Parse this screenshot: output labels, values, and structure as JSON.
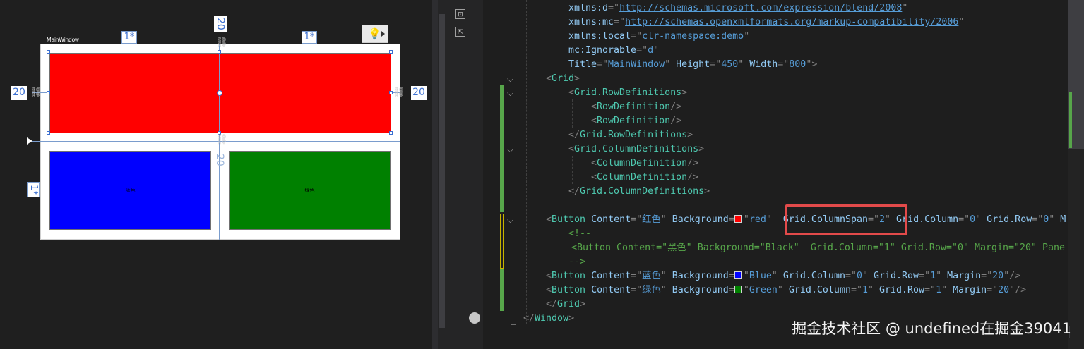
{
  "designer": {
    "window_title": "MainWindow",
    "column_star_left": "1*",
    "column_star_right": "1*",
    "row_star": "1*",
    "margin_top": "20",
    "margin_left": "20",
    "margin_right": "20",
    "margin_middle": "20",
    "red_caption": "",
    "blue_caption": "蓝色",
    "green_caption": "绿色",
    "colors": {
      "red": "#ff0000",
      "blue": "#0000ff",
      "green": "#008000"
    }
  },
  "editor": {
    "highlight_color": "#e24a4a",
    "lines": [
      {
        "id": "l1",
        "parts": [
          [
            "attr",
            "xmlns:d"
          ],
          [
            "punc",
            "=\""
          ],
          [
            "link",
            "http://schemas.microsoft.com/expression/blend/2008"
          ],
          [
            "punc",
            "\""
          ]
        ]
      },
      {
        "id": "l2",
        "parts": [
          [
            "attr",
            "xmlns:mc"
          ],
          [
            "punc",
            "=\""
          ],
          [
            "link",
            "http://schemas.openxmlformats.org/markup-compatibility/2006"
          ],
          [
            "punc",
            "\""
          ]
        ]
      },
      {
        "id": "l3",
        "parts": [
          [
            "attr",
            "xmlns:local"
          ],
          [
            "punc",
            "=\""
          ],
          [
            "val",
            "clr-namespace:demo"
          ],
          [
            "punc",
            "\""
          ]
        ]
      },
      {
        "id": "l4",
        "parts": [
          [
            "attr",
            "mc:Ignorable"
          ],
          [
            "punc",
            "=\""
          ],
          [
            "val",
            "d"
          ],
          [
            "punc",
            "\""
          ]
        ]
      },
      {
        "id": "l5",
        "parts": [
          [
            "attr",
            "Title"
          ],
          [
            "punc",
            "=\""
          ],
          [
            "val",
            "MainWindow"
          ],
          [
            "punc",
            "\" "
          ],
          [
            "attr",
            "Height"
          ],
          [
            "punc",
            "=\""
          ],
          [
            "val",
            "450"
          ],
          [
            "punc",
            "\" "
          ],
          [
            "attr",
            "Width"
          ],
          [
            "punc",
            "=\""
          ],
          [
            "val",
            "800"
          ],
          [
            "punc",
            "\">"
          ]
        ]
      },
      {
        "id": "l6",
        "parts": [
          [
            "punc",
            "<"
          ],
          [
            "tag",
            "Grid"
          ],
          [
            "punc",
            ">"
          ]
        ]
      },
      {
        "id": "l7",
        "parts": [
          [
            "punc",
            "<"
          ],
          [
            "tag",
            "Grid.RowDefinitions"
          ],
          [
            "punc",
            ">"
          ]
        ]
      },
      {
        "id": "l8",
        "parts": [
          [
            "punc",
            "<"
          ],
          [
            "tag",
            "RowDefinition"
          ],
          [
            "punc",
            "/>"
          ]
        ]
      },
      {
        "id": "l9",
        "parts": [
          [
            "punc",
            "<"
          ],
          [
            "tag",
            "RowDefinition"
          ],
          [
            "punc",
            "/>"
          ]
        ]
      },
      {
        "id": "l10",
        "parts": [
          [
            "punc",
            "</"
          ],
          [
            "tag",
            "Grid.RowDefinitions"
          ],
          [
            "punc",
            ">"
          ]
        ]
      },
      {
        "id": "l11",
        "parts": [
          [
            "punc",
            "<"
          ],
          [
            "tag",
            "Grid.ColumnDefinitions"
          ],
          [
            "punc",
            ">"
          ]
        ]
      },
      {
        "id": "l12",
        "parts": [
          [
            "punc",
            "<"
          ],
          [
            "tag",
            "ColumnDefinition"
          ],
          [
            "punc",
            "/>"
          ]
        ]
      },
      {
        "id": "l13",
        "parts": [
          [
            "punc",
            "<"
          ],
          [
            "tag",
            "ColumnDefinition"
          ],
          [
            "punc",
            "/>"
          ]
        ]
      },
      {
        "id": "l14",
        "parts": [
          [
            "punc",
            "</"
          ],
          [
            "tag",
            "Grid.ColumnDefinitions"
          ],
          [
            "punc",
            ">"
          ]
        ]
      },
      {
        "id": "l15",
        "parts": [
          [
            "punc",
            "<"
          ],
          [
            "tag",
            "Button"
          ],
          [
            "text",
            " "
          ],
          [
            "attr",
            "Content"
          ],
          [
            "punc",
            "=\""
          ],
          [
            "val",
            "红色"
          ],
          [
            "punc",
            "\" "
          ],
          [
            "attr",
            "Background"
          ],
          [
            "punc",
            "="
          ],
          [
            "swatch",
            "#ff0000"
          ],
          [
            "punc",
            "\""
          ],
          [
            "val",
            "red"
          ],
          [
            "punc",
            "\"  "
          ],
          [
            "attr",
            "Grid.ColumnSpan"
          ],
          [
            "punc",
            "=\""
          ],
          [
            "val",
            "2"
          ],
          [
            "punc",
            "\" "
          ],
          [
            "attr",
            "Grid.Column"
          ],
          [
            "punc",
            "=\""
          ],
          [
            "val",
            "0"
          ],
          [
            "punc",
            "\" "
          ],
          [
            "attr",
            "Grid.Row"
          ],
          [
            "punc",
            "=\""
          ],
          [
            "val",
            "0"
          ],
          [
            "punc",
            "\" "
          ],
          [
            "attr",
            "M"
          ]
        ]
      },
      {
        "id": "l16",
        "parts": [
          [
            "cmt",
            "<!--"
          ]
        ]
      },
      {
        "id": "l17",
        "parts": [
          [
            "cmt",
            "<Button Content=\"黑色\" Background=\"Black\"  Grid.Column=\"1\" Grid.Row=\"0\" Margin=\"20\" Pane"
          ]
        ]
      },
      {
        "id": "l18",
        "parts": [
          [
            "cmt",
            "-->"
          ]
        ]
      },
      {
        "id": "l19",
        "parts": [
          [
            "punc",
            "<"
          ],
          [
            "tag",
            "Button"
          ],
          [
            "text",
            " "
          ],
          [
            "attr",
            "Content"
          ],
          [
            "punc",
            "=\""
          ],
          [
            "val",
            "蓝色"
          ],
          [
            "punc",
            "\" "
          ],
          [
            "attr",
            "Background"
          ],
          [
            "punc",
            "="
          ],
          [
            "swatch",
            "#0000ff"
          ],
          [
            "punc",
            "\""
          ],
          [
            "val",
            "Blue"
          ],
          [
            "punc",
            "\" "
          ],
          [
            "attr",
            "Grid.Column"
          ],
          [
            "punc",
            "=\""
          ],
          [
            "val",
            "0"
          ],
          [
            "punc",
            "\" "
          ],
          [
            "attr",
            "Grid.Row"
          ],
          [
            "punc",
            "=\""
          ],
          [
            "val",
            "1"
          ],
          [
            "punc",
            "\" "
          ],
          [
            "attr",
            "Margin"
          ],
          [
            "punc",
            "=\""
          ],
          [
            "val",
            "20"
          ],
          [
            "punc",
            "\"/>"
          ]
        ]
      },
      {
        "id": "l20",
        "parts": [
          [
            "punc",
            "<"
          ],
          [
            "tag",
            "Button"
          ],
          [
            "text",
            " "
          ],
          [
            "attr",
            "Content"
          ],
          [
            "punc",
            "=\""
          ],
          [
            "val",
            "绿色"
          ],
          [
            "punc",
            "\" "
          ],
          [
            "attr",
            "Background"
          ],
          [
            "punc",
            "="
          ],
          [
            "swatch",
            "#008000"
          ],
          [
            "punc",
            "\""
          ],
          [
            "val",
            "Green"
          ],
          [
            "punc",
            "\" "
          ],
          [
            "attr",
            "Grid.Column"
          ],
          [
            "punc",
            "=\""
          ],
          [
            "val",
            "1"
          ],
          [
            "punc",
            "\" "
          ],
          [
            "attr",
            "Grid.Row"
          ],
          [
            "punc",
            "=\""
          ],
          [
            "val",
            "1"
          ],
          [
            "punc",
            "\" "
          ],
          [
            "attr",
            "Margin"
          ],
          [
            "punc",
            "=\""
          ],
          [
            "val",
            "20"
          ],
          [
            "punc",
            "\"/>"
          ]
        ]
      },
      {
        "id": "l21",
        "parts": [
          [
            "punc",
            "</"
          ],
          [
            "tag",
            "Grid"
          ],
          [
            "punc",
            ">"
          ]
        ]
      },
      {
        "id": "l22",
        "parts": [
          [
            "punc",
            "</"
          ],
          [
            "tag",
            "Window"
          ],
          [
            "punc",
            ">"
          ]
        ]
      }
    ]
  },
  "watermark": "掘金技术社区 @ undefined在掘金39041"
}
